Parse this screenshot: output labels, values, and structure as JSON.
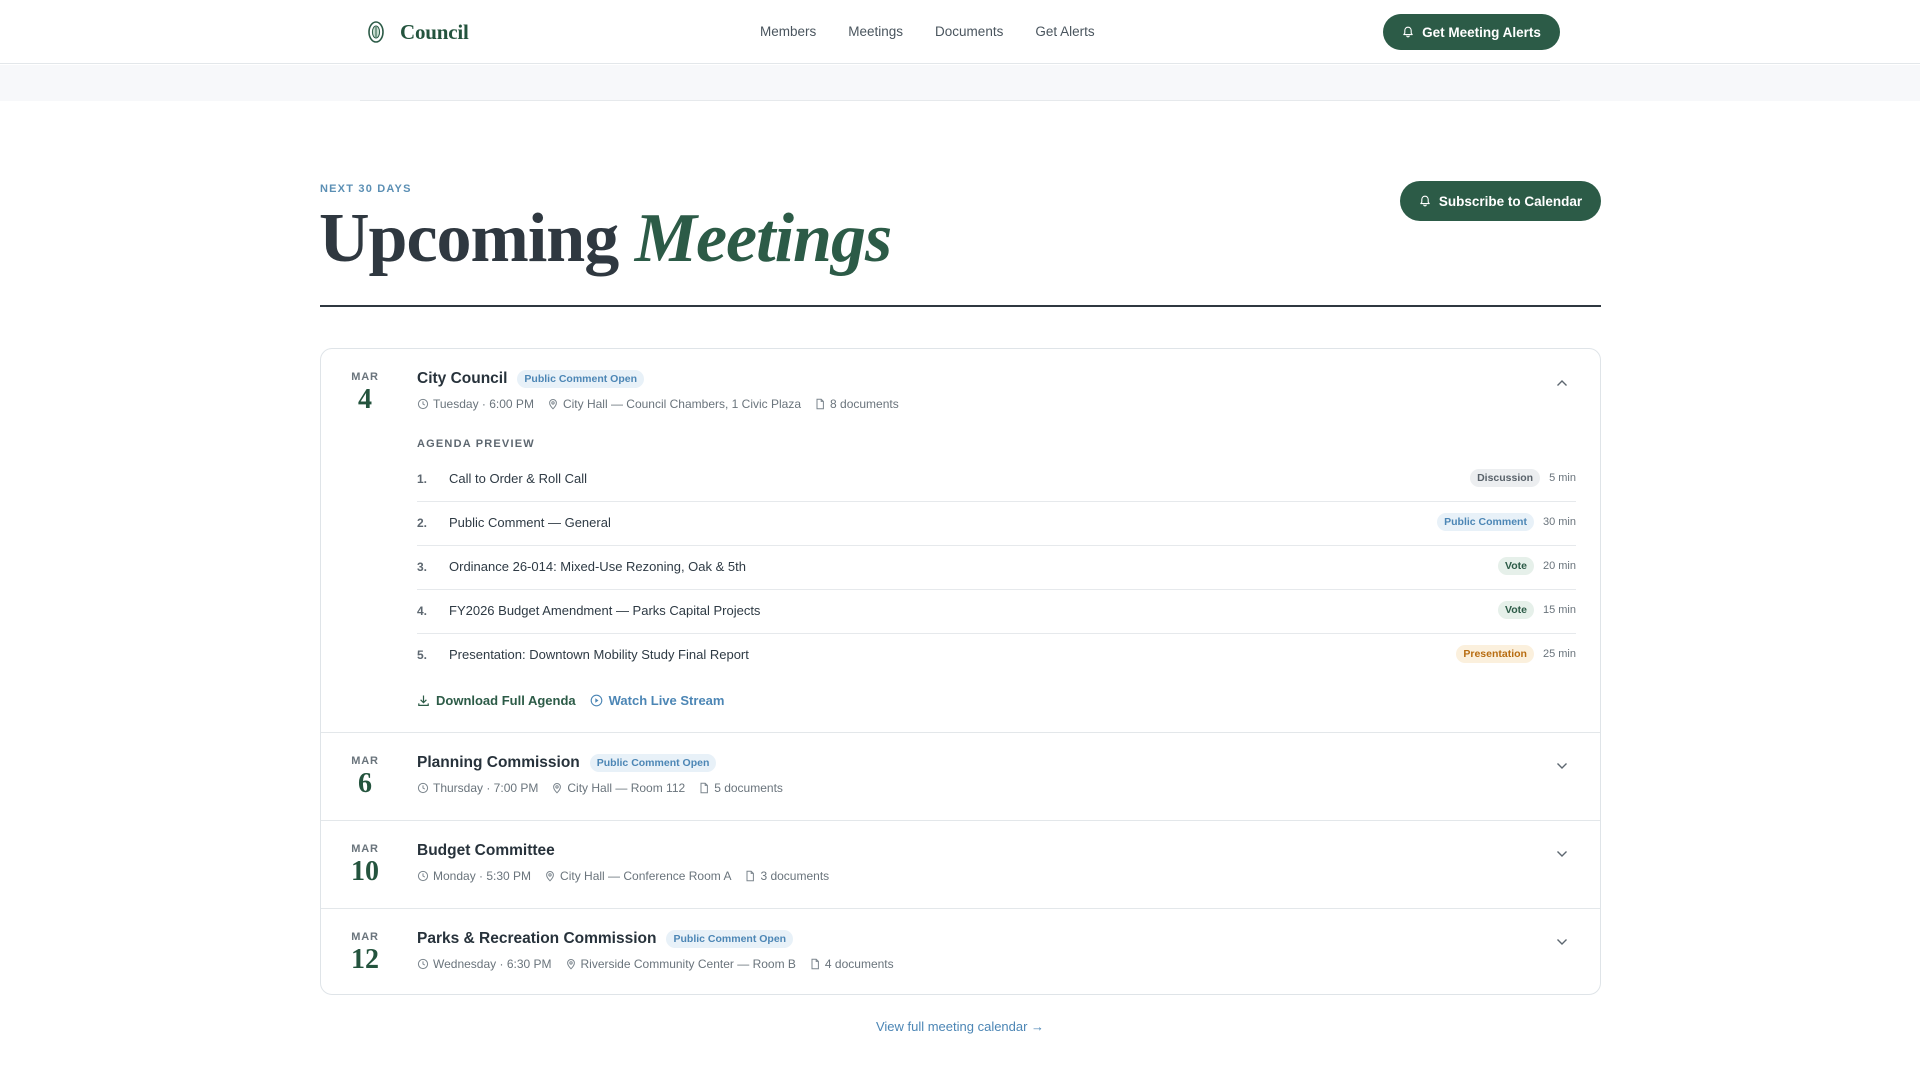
{
  "header": {
    "brand": "Council",
    "nav": [
      "Members",
      "Meetings",
      "Documents",
      "Get Alerts"
    ],
    "alerts_button": "Get Meeting Alerts"
  },
  "section": {
    "eyebrow": "NEXT 30 DAYS",
    "title_plain": "Upcoming",
    "title_italic": "Meetings",
    "subscribe_button": "Subscribe to Calendar"
  },
  "meetings": [
    {
      "month": "MAR",
      "day": "4",
      "title": "City Council",
      "badge": "Public Comment Open",
      "when": "Tuesday · 6:00 PM",
      "where": "City Hall — Council Chambers, 1 Civic Plaza",
      "docs": "8 documents",
      "expanded": true,
      "agenda_label": "AGENDA PREVIEW",
      "agenda": [
        {
          "num": "1.",
          "text": "Call to Order & Roll Call",
          "tag": "Discussion",
          "tag_style": "gray",
          "duration": "5 min"
        },
        {
          "num": "2.",
          "text": "Public Comment — General",
          "tag": "Public Comment",
          "tag_style": "blue",
          "duration": "30 min"
        },
        {
          "num": "3.",
          "text": "Ordinance 26-014: Mixed-Use Rezoning, Oak & 5th",
          "tag": "Vote",
          "tag_style": "green",
          "duration": "20 min"
        },
        {
          "num": "4.",
          "text": "FY2026 Budget Amendment — Parks Capital Projects",
          "tag": "Vote",
          "tag_style": "green",
          "duration": "15 min"
        },
        {
          "num": "5.",
          "text": "Presentation: Downtown Mobility Study Final Report",
          "tag": "Presentation",
          "tag_style": "amber",
          "duration": "25 min"
        }
      ],
      "download_label": "Download Full Agenda",
      "stream_label": "Watch Live Stream"
    },
    {
      "month": "MAR",
      "day": "6",
      "title": "Planning Commission",
      "badge": "Public Comment Open",
      "when": "Thursday · 7:00 PM",
      "where": "City Hall — Room 112",
      "docs": "5 documents",
      "expanded": false
    },
    {
      "month": "MAR",
      "day": "10",
      "title": "Budget Committee",
      "badge": "",
      "when": "Monday · 5:30 PM",
      "where": "City Hall — Conference Room A",
      "docs": "3 documents",
      "expanded": false
    },
    {
      "month": "MAR",
      "day": "12",
      "title": "Parks & Recreation Commission",
      "badge": "Public Comment Open",
      "when": "Wednesday · 6:30 PM",
      "where": "Riverside Community Center — Room B",
      "docs": "4 documents",
      "expanded": false
    }
  ],
  "footer_link": "View full meeting calendar →",
  "colors": {
    "brand_green": "#2c5b47",
    "accent_blue": "#4c86b5",
    "ink": "#2f3840"
  },
  "icons": [
    "seal-icon",
    "bell-icon",
    "clock-icon",
    "pin-icon",
    "document-icon",
    "chevron-up-icon",
    "chevron-down-icon",
    "download-icon",
    "play-circle-icon"
  ]
}
